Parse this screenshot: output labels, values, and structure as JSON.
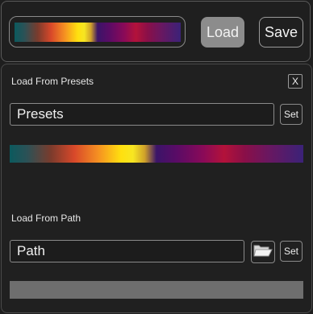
{
  "toolbar": {
    "load_label": "Load",
    "save_label": "Save"
  },
  "presets_section": {
    "title": "Load From Presets",
    "close_label": "X",
    "presets_value": "Presets",
    "set_label": "Set"
  },
  "path_section": {
    "title": "Load From Path",
    "path_value": "Path",
    "set_label": "Set",
    "folder_icon": "folder-icon"
  },
  "colors": {
    "background": "#1e1e1e",
    "load_button": "#8c8c8c",
    "path_preview": "#6e6e6e"
  }
}
